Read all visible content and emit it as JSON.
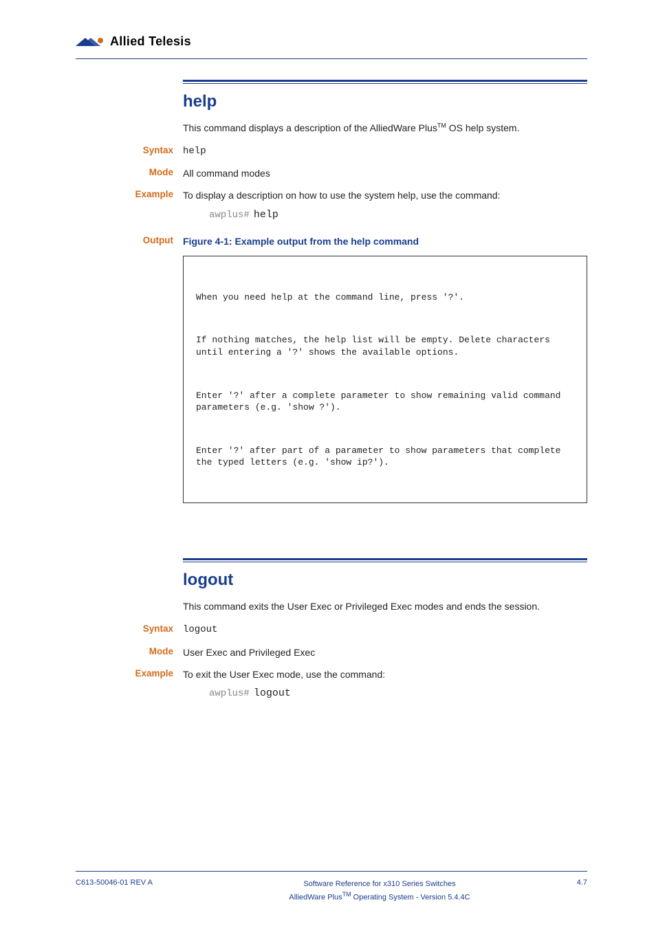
{
  "logo_text": "Allied Telesis",
  "help": {
    "title": "help",
    "intro_before_tm": "This command displays a description of the AlliedWare Plus",
    "tm": "TM",
    "intro_after_tm": " OS help system.",
    "syntax_label": "Syntax",
    "syntax_value": "help",
    "mode_label": "Mode",
    "mode_value": "All command modes",
    "example_label": "Example",
    "example_text": "To display a description on how to use the system help, use the command:",
    "example_prompt": "awplus#",
    "example_cmd": "help",
    "output_label": "Output",
    "output_caption": "Figure 4-1: Example output from the help command",
    "output_lines": {
      "p1": "When you need help at the command line, press '?'.",
      "p2": "If nothing matches, the help list will be empty. Delete characters until entering a '?' shows the available options.",
      "p3": "Enter '?' after a complete parameter to show remaining valid command parameters (e.g. 'show ?').",
      "p4": "Enter '?' after part of a parameter to show parameters that complete the typed letters (e.g. 'show ip?')."
    }
  },
  "logout": {
    "title": "logout",
    "intro": "This command exits the User Exec or Privileged Exec modes and ends the session.",
    "syntax_label": "Syntax",
    "syntax_value": "logout",
    "mode_label": "Mode",
    "mode_value": "User Exec and Privileged Exec",
    "example_label": "Example",
    "example_text": "To exit the User Exec mode, use the command:",
    "example_prompt": "awplus#",
    "example_cmd": "logout"
  },
  "footer": {
    "left": "C613-50046-01 REV A",
    "line1": "Software Reference for x310 Series Switches",
    "line2_before_tm": "AlliedWare Plus",
    "tm": "TM",
    "line2_after_tm": " Operating System - Version 5.4.4C",
    "page": "4.7"
  }
}
